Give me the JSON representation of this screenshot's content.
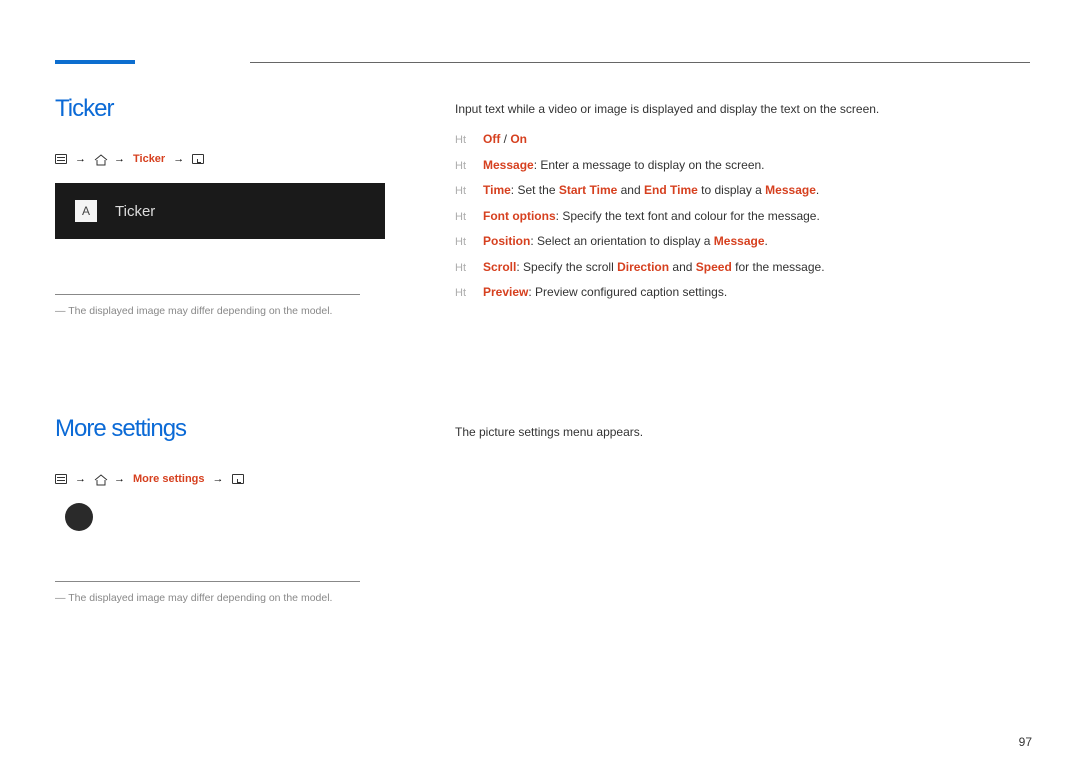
{
  "page_number": "97",
  "section1": {
    "title": "Ticker",
    "path_label": "Ticker",
    "box_letter": "A",
    "box_text": "Ticker",
    "disclaimer": "The displayed image may differ depending on the model."
  },
  "section2": {
    "title": "More settings",
    "path_label": "More settings",
    "disclaimer": "The displayed image may differ depending on the model."
  },
  "right1": {
    "intro": "Input text while a video or image is displayed and display the text on the screen.",
    "items": {
      "b0": {
        "hl": "Off",
        "sep": " / ",
        "hl2": "On"
      },
      "b1": {
        "hl": "Message",
        "text": ": Enter a message to display on the screen."
      },
      "b2": {
        "hl": "Time",
        "p1": ": Set the ",
        "hl2": "Start Time",
        "p2": " and ",
        "hl3": "End Time",
        "p3": " to display a ",
        "hl4": "Message",
        "p4": "."
      },
      "b3": {
        "hl": "Font options",
        "text": ": Specify the text font and colour for the message."
      },
      "b4": {
        "hl": "Position",
        "p1": ": Select an orientation to display a ",
        "hl2": "Message",
        "p2": "."
      },
      "b5": {
        "hl": "Scroll",
        "p1": ": Specify the scroll ",
        "hl2": "Direction",
        "p2": " and ",
        "hl3": "Speed",
        "p3": " for the message."
      },
      "b6": {
        "hl": "Preview",
        "text": ": Preview configured caption settings."
      }
    }
  },
  "right2": {
    "text": "The picture settings menu appears."
  },
  "glyphs": {
    "arrow": "→",
    "bullet": "Ht",
    "dash": "―"
  }
}
